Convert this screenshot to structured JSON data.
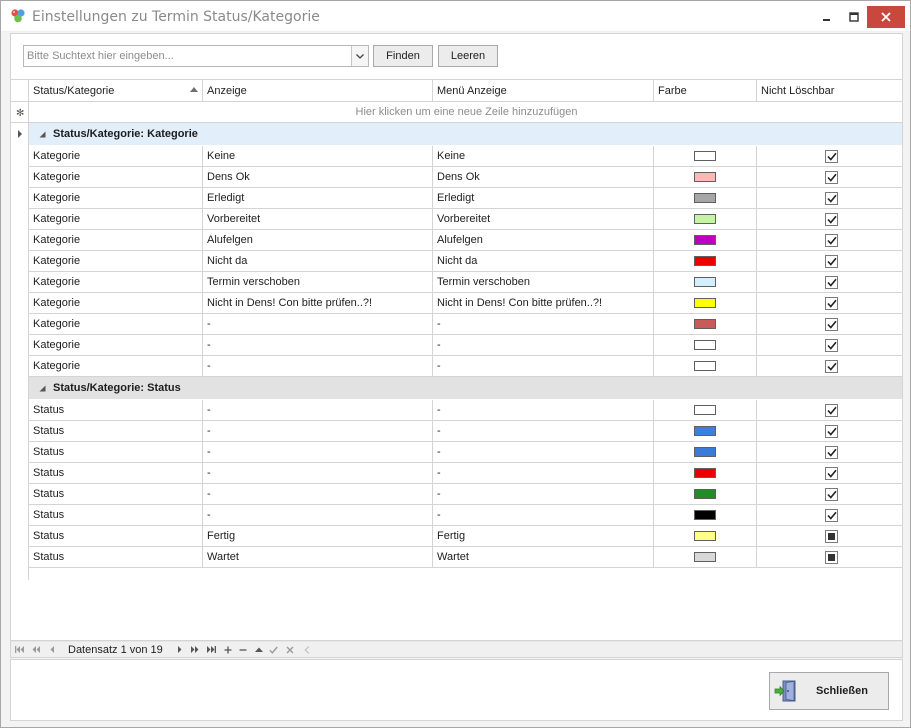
{
  "window": {
    "title": "Einstellungen zu Termin Status/Kategorie",
    "icon": "app-bubbles-icon"
  },
  "search": {
    "placeholder": "Bitte Suchtext hier eingeben...",
    "find_label": "Finden",
    "clear_label": "Leeren"
  },
  "grid": {
    "columns": [
      "Status/Kategorie",
      "Anzeige",
      "Menü Anzeige",
      "Farbe",
      "Nicht Löschbar"
    ],
    "sort_column": "Status/Kategorie",
    "sort_direction": "ascending",
    "new_row_hint": "Hier klicken um eine neue Zeile hinzuzufügen",
    "groups": [
      {
        "label": "Status/Kategorie: Kategorie",
        "rows": [
          {
            "kategorie": "Kategorie",
            "anzeige": "Keine",
            "menu": "Keine",
            "color": "#ffffff",
            "locked": true
          },
          {
            "kategorie": "Kategorie",
            "anzeige": "Dens Ok",
            "menu": "Dens Ok",
            "color": "#ffb7b7",
            "locked": true
          },
          {
            "kategorie": "Kategorie",
            "anzeige": "Erledigt",
            "menu": "Erledigt",
            "color": "#a6a6a6",
            "locked": true
          },
          {
            "kategorie": "Kategorie",
            "anzeige": "Vorbereitet",
            "menu": "Vorbereitet",
            "color": "#c4f5a5",
            "locked": true
          },
          {
            "kategorie": "Kategorie",
            "anzeige": "Alufelgen",
            "menu": "Alufelgen",
            "color": "#c000c0",
            "locked": true
          },
          {
            "kategorie": "Kategorie",
            "anzeige": "Nicht da",
            "menu": "Nicht da",
            "color": "#ee0000",
            "locked": true
          },
          {
            "kategorie": "Kategorie",
            "anzeige": "Termin verschoben",
            "menu": "Termin verschoben",
            "color": "#d3efff",
            "locked": true
          },
          {
            "kategorie": "Kategorie",
            "anzeige": "Nicht in Dens! Con bitte prüfen..?!",
            "menu": "Nicht in Dens! Con bitte prüfen..?!",
            "color": "#ffff00",
            "locked": true
          },
          {
            "kategorie": "Kategorie",
            "anzeige": "-",
            "menu": "-",
            "color": "#c85a5a",
            "locked": true
          },
          {
            "kategorie": "Kategorie",
            "anzeige": "-",
            "menu": "-",
            "color": "#ffffff",
            "locked": true
          },
          {
            "kategorie": "Kategorie",
            "anzeige": "-",
            "menu": "-",
            "color": "#ffffff",
            "locked": true
          }
        ]
      },
      {
        "label": "Status/Kategorie: Status",
        "rows": [
          {
            "kategorie": "Status",
            "anzeige": "-",
            "menu": "-",
            "color": "#ffffff",
            "locked": true
          },
          {
            "kategorie": "Status",
            "anzeige": "-",
            "menu": "-",
            "color": "#3c7fe0",
            "locked": true
          },
          {
            "kategorie": "Status",
            "anzeige": "-",
            "menu": "-",
            "color": "#3a7ad8",
            "locked": true
          },
          {
            "kategorie": "Status",
            "anzeige": "-",
            "menu": "-",
            "color": "#ee0000",
            "locked": true
          },
          {
            "kategorie": "Status",
            "anzeige": "-",
            "menu": "-",
            "color": "#228b22",
            "locked": true
          },
          {
            "kategorie": "Status",
            "anzeige": "-",
            "menu": "-",
            "color": "#000000",
            "locked": true
          },
          {
            "kategorie": "Status",
            "anzeige": "Fertig",
            "menu": "Fertig",
            "color": "#ffff88",
            "locked": false
          },
          {
            "kategorie": "Status",
            "anzeige": "Wartet",
            "menu": "Wartet",
            "color": "#d8d8d8",
            "locked": false
          }
        ]
      }
    ]
  },
  "navigator": {
    "record_text": "Datensatz 1 von 19"
  },
  "footer": {
    "close_label": "Schließen"
  }
}
